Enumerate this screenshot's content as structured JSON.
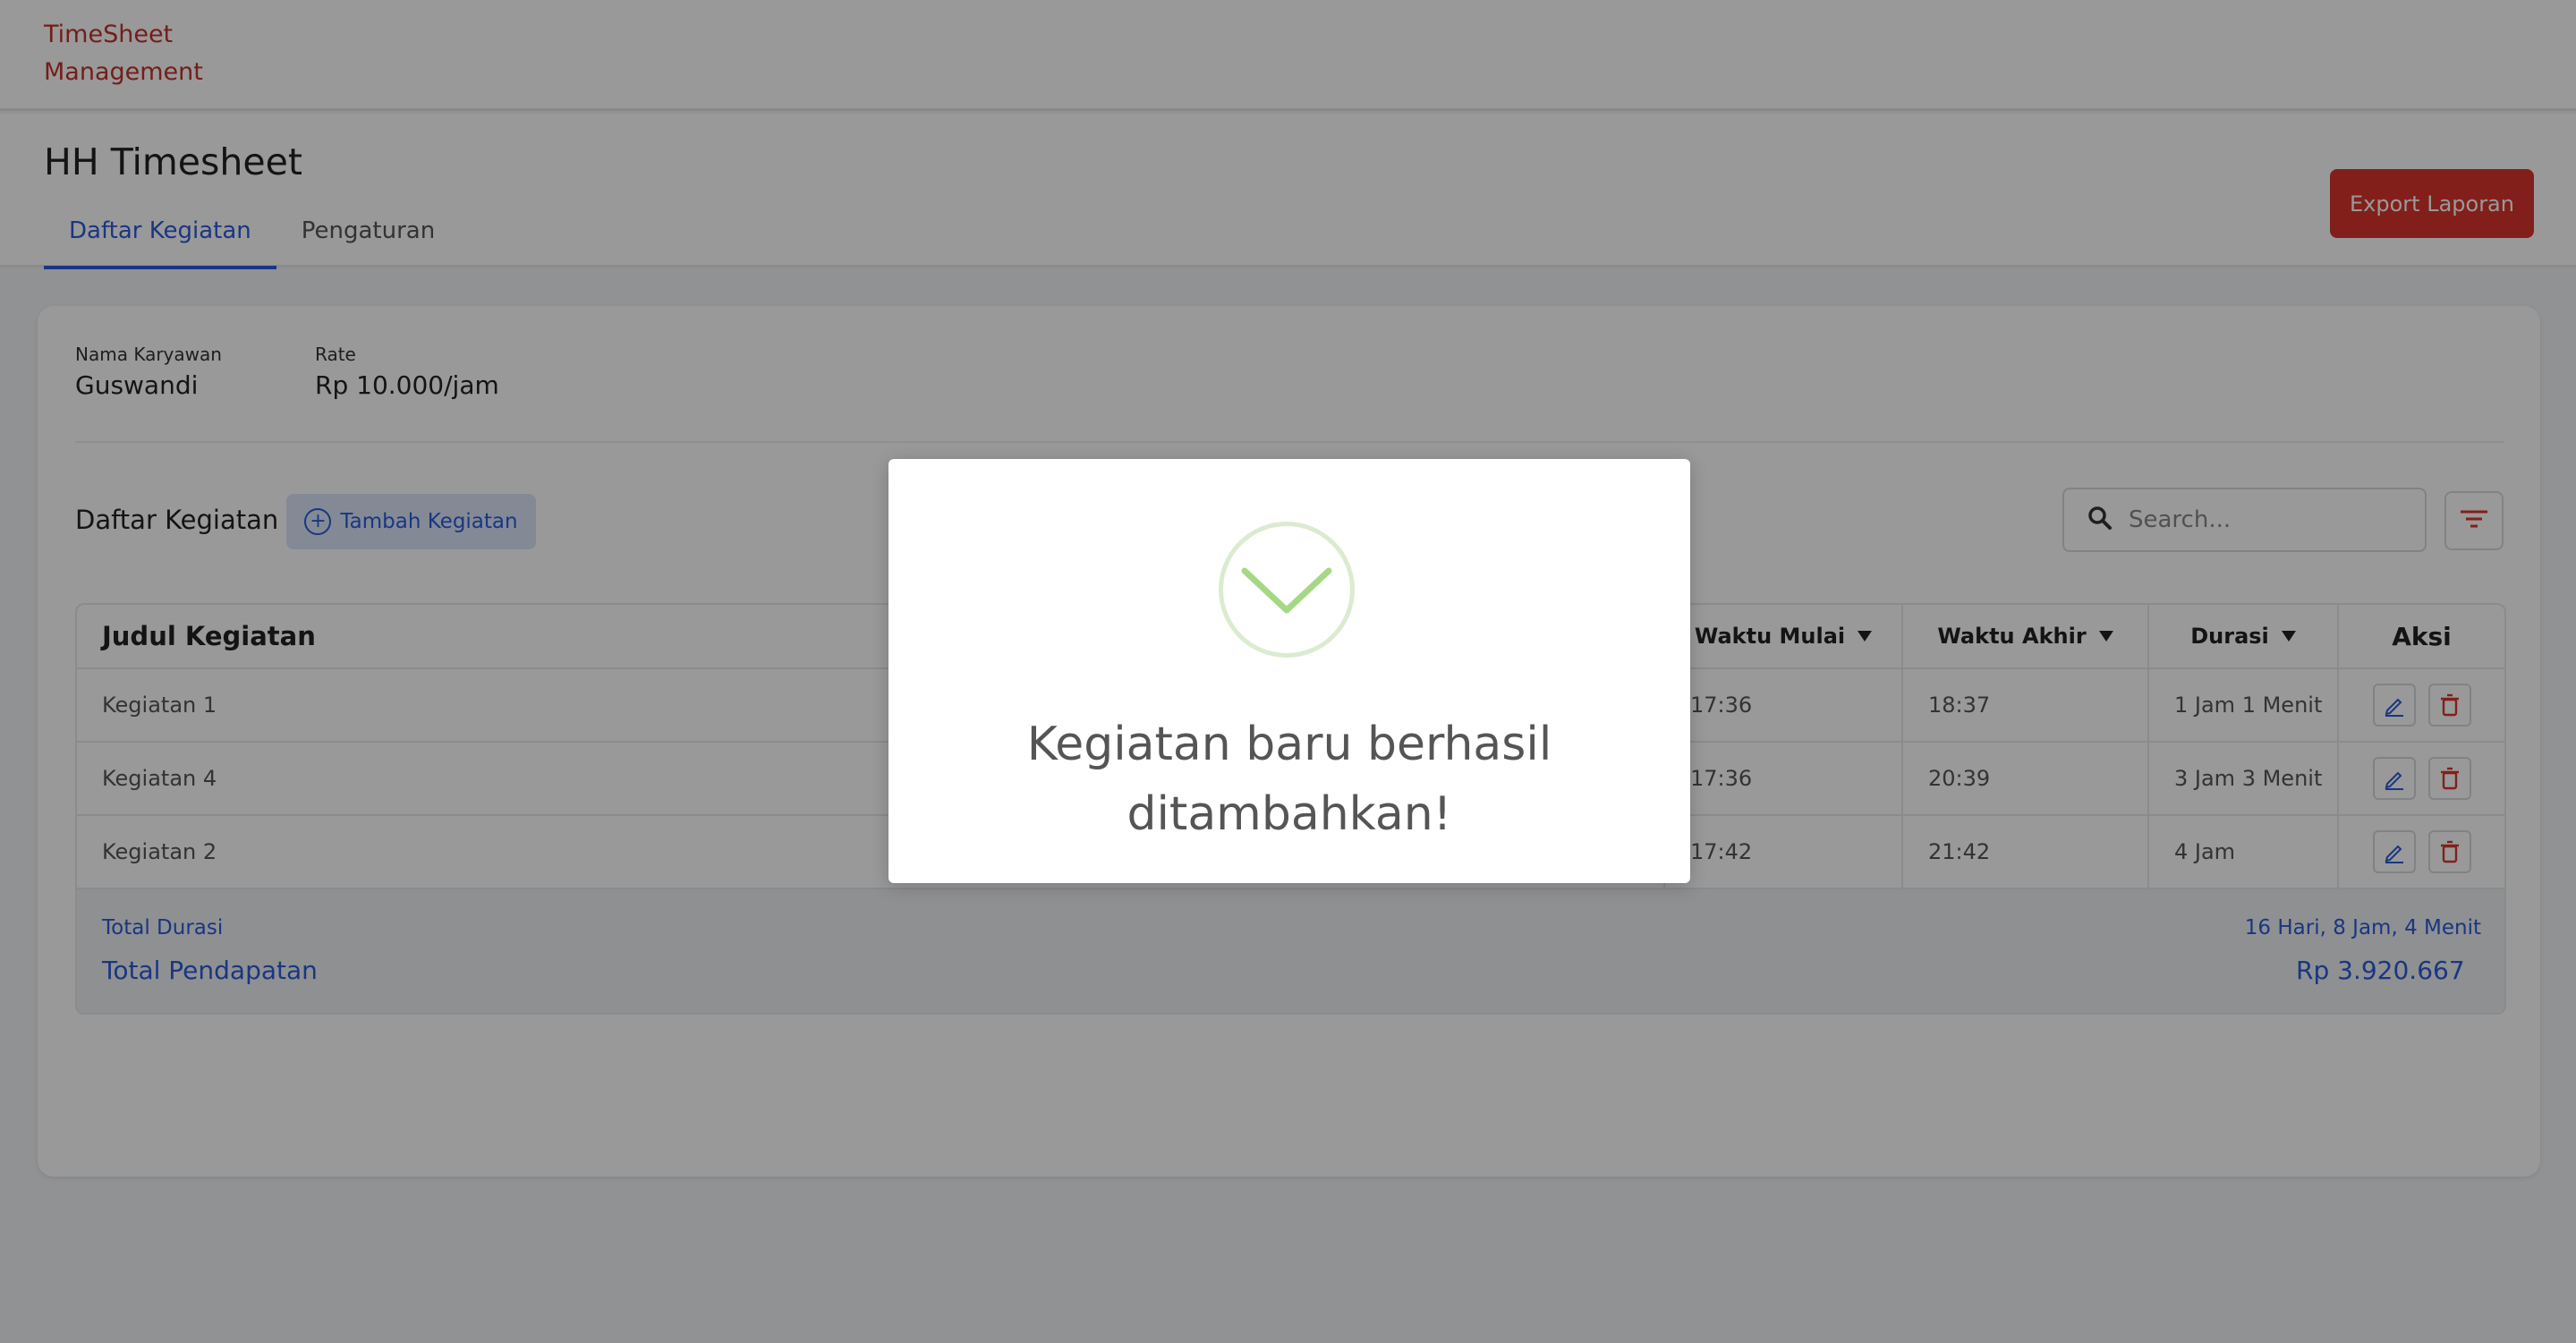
{
  "app": {
    "brand_line1": "TimeSheet",
    "brand_line2": "Management"
  },
  "header": {
    "title": "HH Timesheet",
    "tabs": [
      {
        "label": "Daftar Kegiatan",
        "active": true
      },
      {
        "label": "Pengaturan",
        "active": false
      }
    ],
    "export_label": "Export Laporan"
  },
  "employee": {
    "name_label": "Nama Karyawan",
    "name_value": "Guswandi",
    "rate_label": "Rate",
    "rate_value": "Rp 10.000/jam"
  },
  "activities": {
    "section_title": "Daftar Kegiatan",
    "add_label": "Tambah Kegiatan",
    "search_placeholder": "Search...",
    "columns": {
      "title": "Judul Kegiatan",
      "start": "Waktu Mulai",
      "end": "Waktu Akhir",
      "duration": "Durasi",
      "actions": "Aksi"
    },
    "rows": [
      {
        "title": "Kegiatan 1",
        "start": "17:36",
        "end": "18:37",
        "duration": "1 Jam 1 Menit"
      },
      {
        "title": "Kegiatan 4",
        "start": "17:36",
        "end": "20:39",
        "duration": "3 Jam 3 Menit"
      },
      {
        "title": "Kegiatan 2",
        "start": "17:42",
        "end": "21:42",
        "duration": "4 Jam"
      }
    ],
    "totals": {
      "duration_label": "Total Durasi",
      "duration_value": "16 Hari, 8 Jam, 4 Menit",
      "income_label": "Total Pendapatan",
      "income_value": "Rp 3.920.667"
    }
  },
  "modal": {
    "message_line1": "Kegiatan baru berhasil",
    "message_line2": "ditambahkan!",
    "icon": "check-icon"
  },
  "colors": {
    "brand": "#c0332e",
    "accent": "#2a5bd7",
    "danger": "#d9352c",
    "success": "#8fcc6a"
  }
}
